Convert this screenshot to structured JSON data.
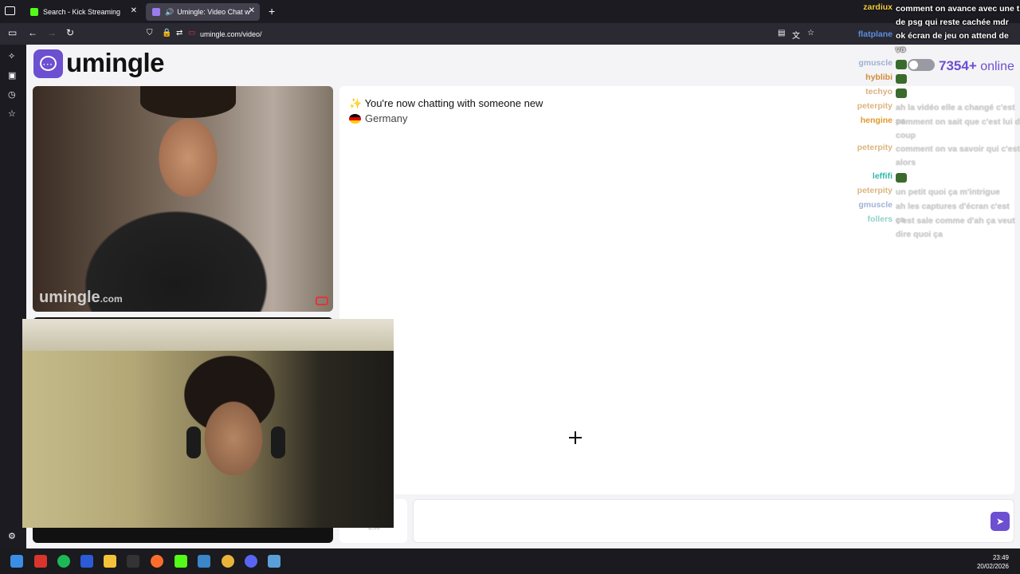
{
  "browser": {
    "tabs": [
      {
        "label": "Search - Kick Streaming",
        "favicon_color": "#53fc18"
      },
      {
        "label": "Umingle: Video Chat with S",
        "favicon_color": "#9b7bf0"
      }
    ],
    "url": "umingle.com/video/"
  },
  "page": {
    "logo_text": "umingle",
    "online_count": "7354+",
    "online_label": "online",
    "chat_system_message": "You're now chatting with someone new",
    "chat_sparkle": "✨",
    "country": "Germany",
    "watermark_main": "umingle",
    "watermark_domain": ".com",
    "esc_label": "Esc"
  },
  "chat_overlay": [
    {
      "user": "zardiux",
      "message": "comment on avance avec une t de psg qui reste cachée mdr",
      "faint": false
    },
    {
      "user": "flatplane",
      "message": "ok écran de jeu on attend de vo",
      "faint": false
    },
    {
      "user": "",
      "message": "ça",
      "faint": true
    },
    {
      "user": "gmuscle",
      "message": "",
      "faint": true,
      "emote": true
    },
    {
      "user": "hyblibi",
      "message": "",
      "faint": true,
      "emote": true
    },
    {
      "user": "techyo",
      "message": "",
      "faint": true,
      "emote": true
    },
    {
      "user": "peterpity",
      "message": "ah la vidéo elle a changé c'est pa",
      "faint": true
    },
    {
      "user": "hengine",
      "message": "comment on sait que c'est lui d coup",
      "faint": true
    },
    {
      "user": "peterpity",
      "message": "comment on va savoir qui c'est alors",
      "faint": true
    },
    {
      "user": "leffifi",
      "message": "",
      "faint": true,
      "emote": true
    },
    {
      "user": "peterpity",
      "message": "un petit quoi ça m'intrigue",
      "faint": true
    },
    {
      "user": "gmuscle",
      "message": "ah les captures d'écran c'est ça",
      "faint": true
    },
    {
      "user": "follers",
      "message": "c'est sale comme d'ah ça veut dire quoi ça",
      "faint": true
    }
  ],
  "taskbar": {
    "time": "23:49",
    "date": "20/02/2026"
  },
  "colors": {
    "accent": "#6d4fd1",
    "browser_bg": "#1c1b22"
  }
}
